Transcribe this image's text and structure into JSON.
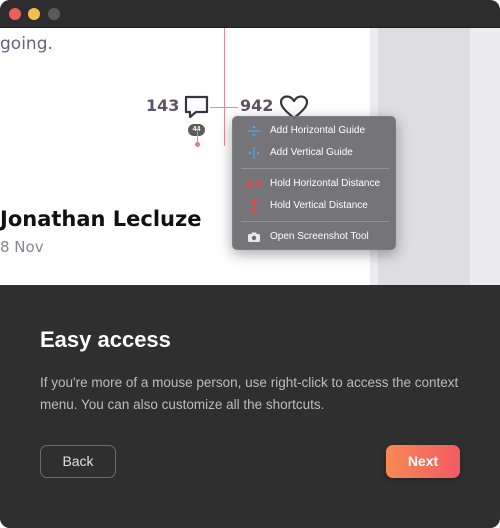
{
  "window": {
    "traffic_lights": {
      "close": "#ec5f5a",
      "minimize": "#f4be4f",
      "maximize": "#5a5a5a"
    }
  },
  "preview": {
    "text_snippet": "going.",
    "comments_count": "143",
    "comment_badge": "44",
    "likes_count": "942",
    "author_name": "Jonathan Lecluze",
    "post_date": "8 Nov"
  },
  "context_menu": {
    "items": [
      {
        "label": "Add Horizontal Guide",
        "icon": "horizontal-guide-icon"
      },
      {
        "label": "Add Vertical Guide",
        "icon": "vertical-guide-icon"
      },
      {
        "label": "Hold Horizontal Distance",
        "icon": "horizontal-distance-icon"
      },
      {
        "label": "Hold Vertical Distance",
        "icon": "vertical-distance-icon"
      },
      {
        "label": "Open Screenshot Tool",
        "icon": "camera-icon"
      }
    ]
  },
  "onboarding": {
    "title": "Easy access",
    "description": "If you're more of a mouse person, use right-click to access the context menu. You can also customize all the shortcuts.",
    "back_label": "Back",
    "next_label": "Next"
  },
  "colors": {
    "accent_gradient_start": "#f68a54",
    "accent_gradient_end": "#f25a63",
    "guide": "#e8889a",
    "distance": "#e04a4a",
    "guide_blue": "#5aa0e6"
  }
}
